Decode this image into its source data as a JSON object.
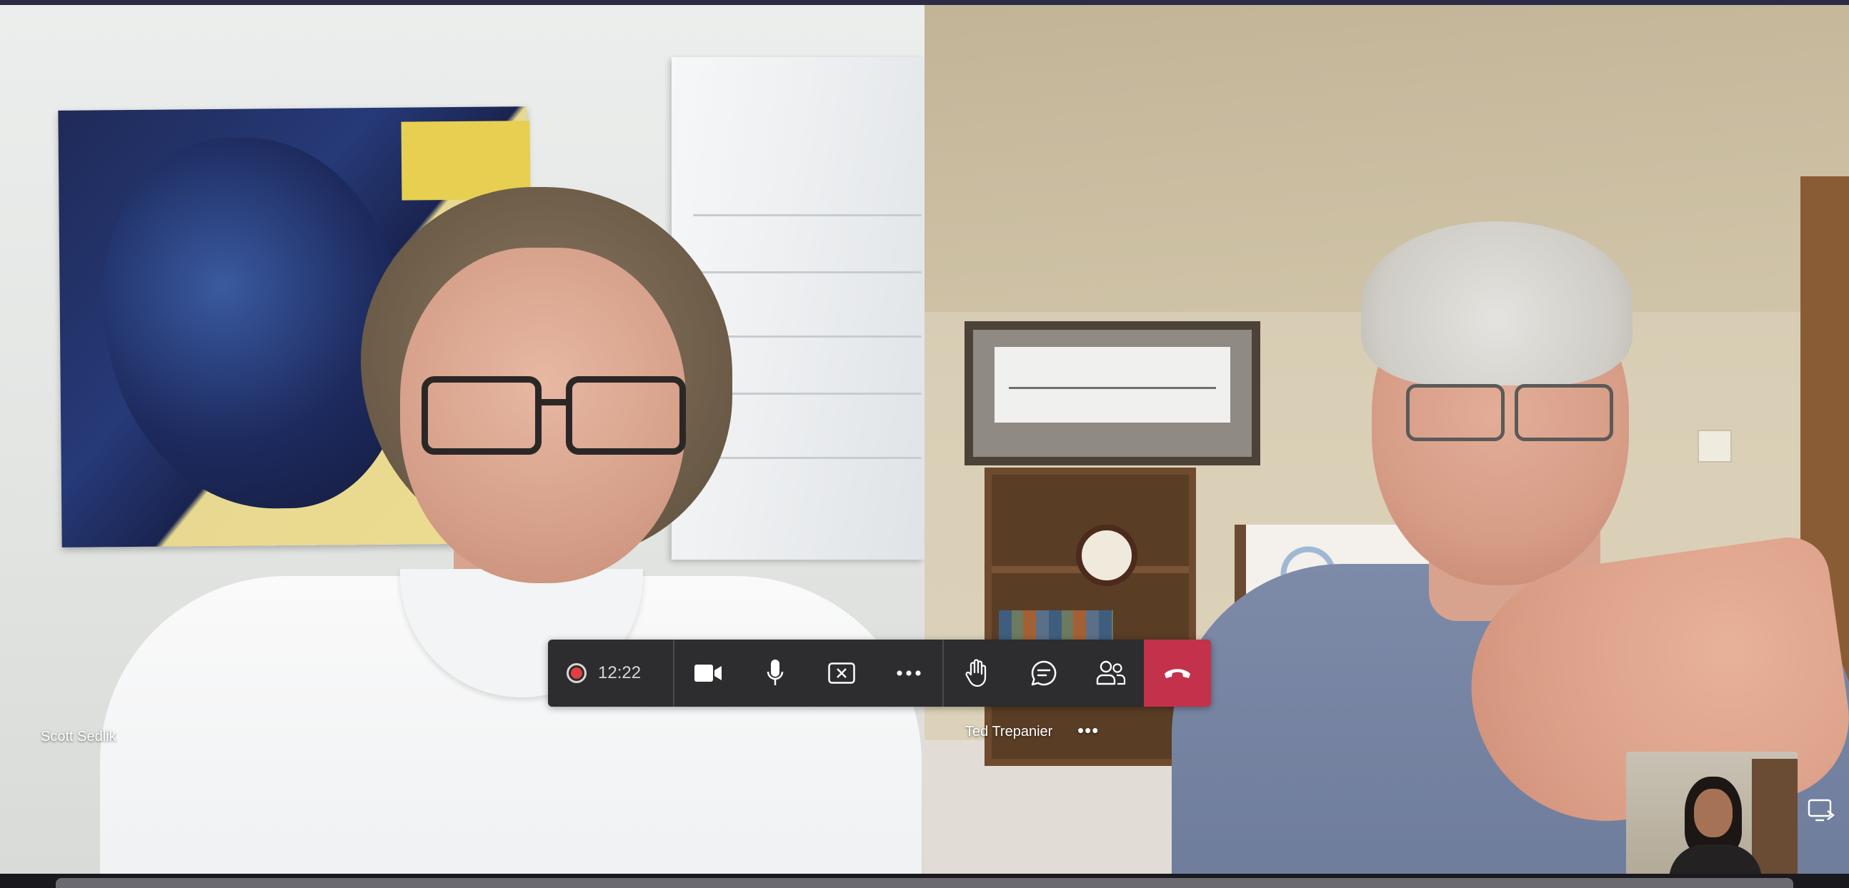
{
  "participants": [
    {
      "name": "Scott Sedlik"
    },
    {
      "name": "Ted Trepanier",
      "more_label": "•••"
    }
  ],
  "controls": {
    "recording_active": true,
    "timer": "12:22",
    "buttons": [
      "camera-icon",
      "microphone-icon",
      "share-screen-icon",
      "more-icon",
      "raise-hand-icon",
      "chat-icon",
      "participants-icon",
      "hang-up-icon"
    ]
  },
  "colors": {
    "record": "#e0403f",
    "hangup": "#c4314b",
    "control_bar": "#2d2c2f"
  }
}
